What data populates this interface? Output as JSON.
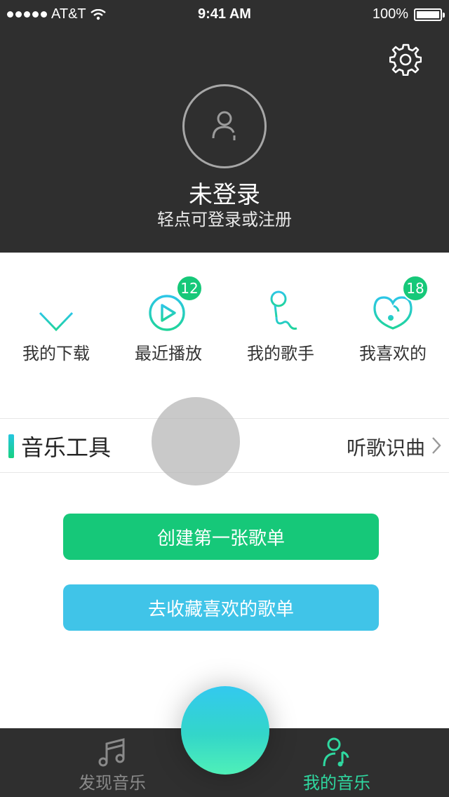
{
  "status": {
    "carrier": "AT&T",
    "time": "9:41 AM",
    "battery": "100%"
  },
  "header": {
    "title": "未登录",
    "subtitle": "轻点可登录或注册"
  },
  "quick_items": [
    {
      "label": "我的下载",
      "icon": "download-icon"
    },
    {
      "label": "最近播放",
      "icon": "play-circle-icon",
      "badge": "12"
    },
    {
      "label": "我的歌手",
      "icon": "microphone-icon"
    },
    {
      "label": "我喜欢的",
      "icon": "heart-music-icon",
      "badge": "18"
    }
  ],
  "tools": {
    "title": "音乐工具",
    "link": "听歌识曲"
  },
  "buttons": {
    "create": "创建第一张歌单",
    "collect": "去收藏喜欢的歌单"
  },
  "tabs": [
    {
      "label": "发现音乐",
      "icon": "music-note-icon",
      "active": false
    },
    {
      "label": "我的音乐",
      "icon": "user-music-icon",
      "active": true
    }
  ],
  "colors": {
    "header": "#2f2f2f",
    "accent_green": "#16c879",
    "accent_blue": "#40c4e8",
    "tab_active": "#2fd8a0",
    "tab_inactive": "#8a8a8a"
  }
}
